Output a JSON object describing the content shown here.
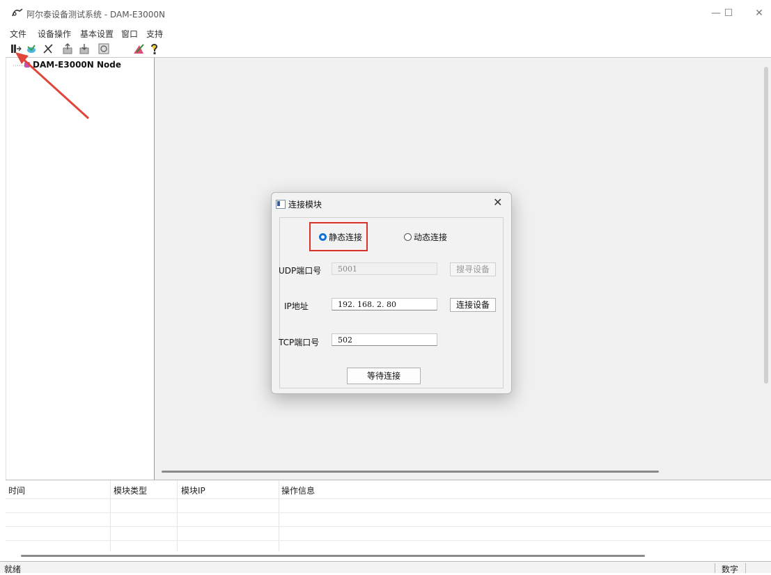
{
  "window": {
    "title": "阿尔泰设备测试系统 - DAM-E3000N"
  },
  "window_buttons": {
    "minimize": "—",
    "maximize": "☐",
    "close": "✕"
  },
  "menu": [
    "文件",
    "设备操作",
    "基本设置",
    "窗口",
    "支持"
  ],
  "tree": {
    "root_label": "DAM-E3000N Node"
  },
  "dialog": {
    "title": "连接模块",
    "close": "✕",
    "radio_static": "静态连接",
    "radio_dynamic": "动态连接",
    "selected_mode": "静态连接",
    "udp_label": "UDP端口号",
    "udp_value": "5001",
    "search_button": "搜寻设备",
    "ip_label": "IP地址",
    "ip_value": "192. 168. 2. 80",
    "connect_button": "连接设备",
    "tcp_label": "TCP端口号",
    "tcp_value": "502",
    "wait_button": "等待连接"
  },
  "log": {
    "columns": [
      "时间",
      "模块类型",
      "模块IP",
      "操作信息"
    ]
  },
  "status": {
    "left": "就绪",
    "right": "数字"
  },
  "colors": {
    "highlight_box": "#d9322b",
    "arrow": "#e0453a",
    "radio_selected": "#1570d6"
  }
}
